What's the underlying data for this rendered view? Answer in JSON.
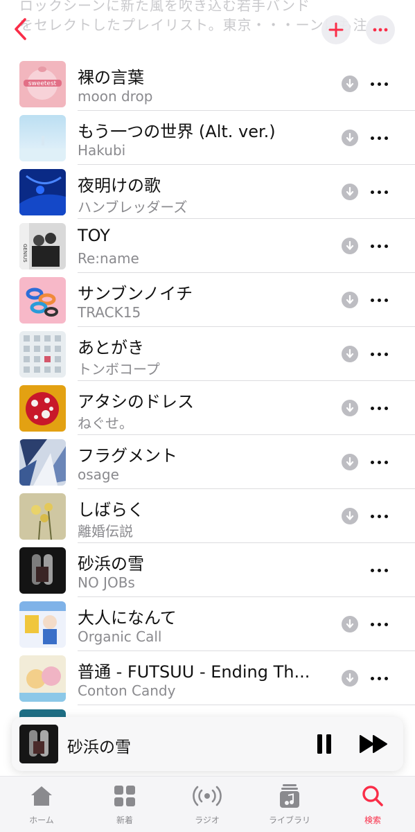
{
  "header": {
    "bg_text_line1": "ロックシーンに新た風を吹き込む若手バンド",
    "bg_text_line2": "をセレクトしたプレイリスト。東京・・・ーンにも注",
    "accent_color": "#fa2d48"
  },
  "tracks": [
    {
      "title": "裸の言葉",
      "artist": "moon drop",
      "downloadable": true
    },
    {
      "title": "もう一つの世界 (Alt. ver.)",
      "artist": "Hakubi",
      "downloadable": true
    },
    {
      "title": "夜明けの歌",
      "artist": "ハンブレッダーズ",
      "downloadable": true
    },
    {
      "title": "TOY",
      "artist": "Re:name",
      "downloadable": true
    },
    {
      "title": "サンブンノイチ",
      "artist": "TRACK15",
      "downloadable": true
    },
    {
      "title": "あとがき",
      "artist": "トンボコープ",
      "downloadable": true
    },
    {
      "title": "アタシのドレス",
      "artist": "ねぐせ。",
      "downloadable": true
    },
    {
      "title": "フラグメント",
      "artist": "osage",
      "downloadable": true
    },
    {
      "title": "しばらく",
      "artist": "離婚伝説",
      "downloadable": true
    },
    {
      "title": "砂浜の雪",
      "artist": "NO JOBs",
      "downloadable": false
    },
    {
      "title": "大人になんて",
      "artist": "Organic Call",
      "downloadable": true
    },
    {
      "title": "普通 - FUTSUU - Ending Th...",
      "artist": "Conton Candy",
      "downloadable": true
    },
    {
      "title": "",
      "artist": "",
      "downloadable": false
    }
  ],
  "mini_player": {
    "title": "砂浜の雪"
  },
  "tabs": [
    {
      "label": "ホーム",
      "icon": "home-icon"
    },
    {
      "label": "新着",
      "icon": "grid-icon"
    },
    {
      "label": "ラジオ",
      "icon": "radio-icon"
    },
    {
      "label": "ライブラリ",
      "icon": "library-icon"
    },
    {
      "label": "検索",
      "icon": "search-icon"
    }
  ],
  "active_tab": "検索"
}
